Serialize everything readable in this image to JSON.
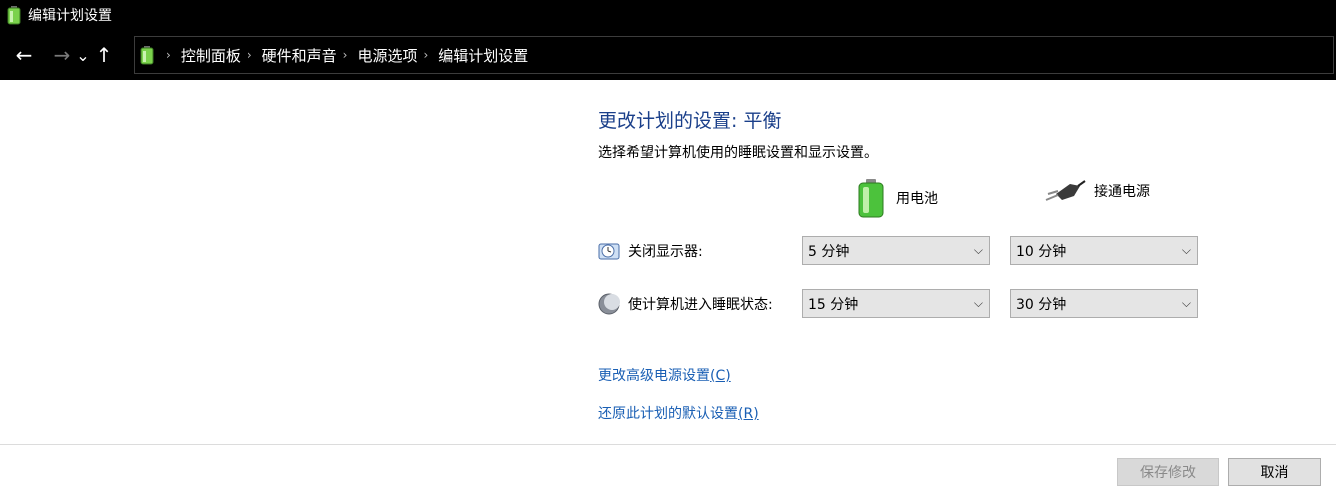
{
  "window": {
    "title": "编辑计划设置",
    "icon": "battery-power-icon"
  },
  "nav": {
    "back_icon": "←",
    "forward_icon": "→",
    "recent_icon": "⌄",
    "up_icon": "↑",
    "breadcrumb": [
      {
        "label": "控制面板"
      },
      {
        "label": "硬件和声音"
      },
      {
        "label": "电源选项"
      },
      {
        "label": "编辑计划设置"
      }
    ],
    "separator": "›"
  },
  "main": {
    "heading": "更改计划的设置: 平衡",
    "subtitle": "选择希望计算机使用的睡眠设置和显示设置。",
    "columns": {
      "battery": {
        "label": "用电池",
        "icon": "battery-icon"
      },
      "plugged": {
        "label": "接通电源",
        "icon": "power-plug-icon"
      }
    },
    "rows": [
      {
        "label": "关闭显示器:",
        "icon": "display-clock-icon",
        "battery_value": "5 分钟",
        "plugged_value": "10 分钟"
      },
      {
        "label": "使计算机进入睡眠状态:",
        "icon": "sleep-moon-icon",
        "battery_value": "15 分钟",
        "plugged_value": "30 分钟"
      }
    ],
    "links": {
      "advanced": {
        "text": "更改高级电源设置",
        "accel": "(C)"
      },
      "restore": {
        "text": "还原此计划的默认设置",
        "accel": "(R)"
      }
    }
  },
  "footer": {
    "save_label": "保存修改",
    "cancel_label": "取消"
  },
  "colors": {
    "heading": "#1a3f8a",
    "link": "#1a5fb4",
    "titlebar": "#000000"
  }
}
